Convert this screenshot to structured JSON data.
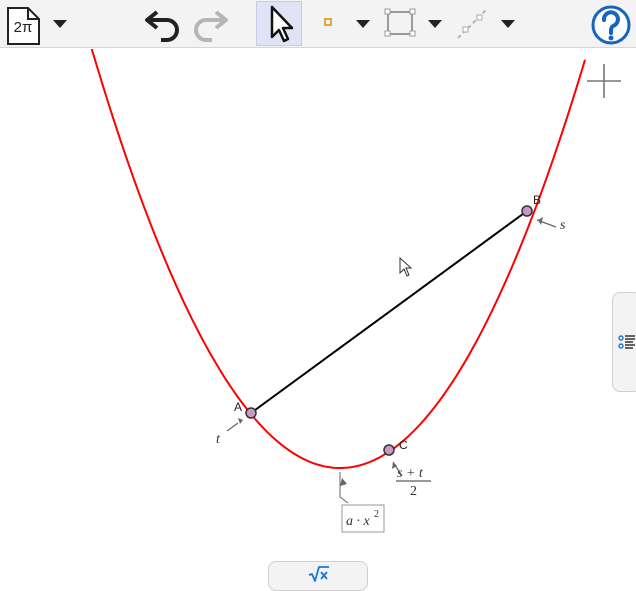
{
  "toolbar": {
    "file_label": "2π",
    "icons": [
      "file-icon",
      "undo-icon",
      "redo-icon",
      "move-cursor-icon",
      "point-icon",
      "segment-icon",
      "line-icon",
      "help-icon"
    ]
  },
  "canvas": {
    "curve_color": "#ff0000",
    "segment_color": "#000000",
    "point_color": "#c79ac6",
    "points": {
      "A": {
        "label": "A"
      },
      "B": {
        "label": "B"
      },
      "C": {
        "label": "C"
      }
    },
    "param_labels": {
      "t": "t",
      "s": "s",
      "c_num": "s + t",
      "c_den": "2"
    },
    "vertex_label": {
      "base": "a · x",
      "exp": "2"
    }
  },
  "sidebar": {
    "icon": "algebra-view-icon"
  },
  "bottom": {
    "icon": "input-bar-icon",
    "label": "√x"
  }
}
